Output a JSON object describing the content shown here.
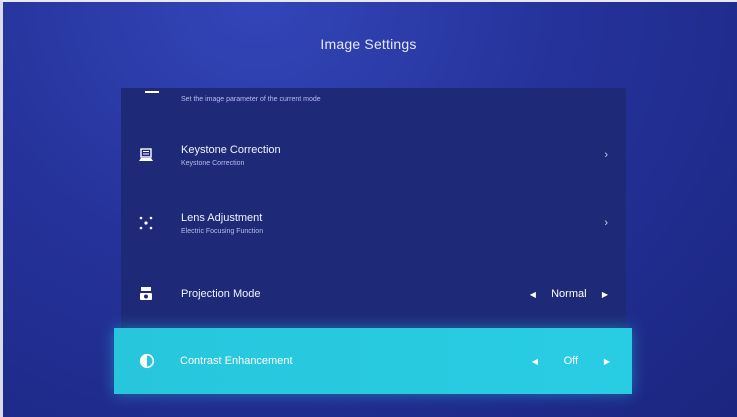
{
  "header": {
    "title": "Image Settings"
  },
  "list": {
    "top_item": {
      "description": "Set the image parameter of the current mode"
    },
    "items": [
      {
        "icon": "keystone-icon",
        "label": "Keystone Correction",
        "subtitle": "Keystone Correction",
        "control": "chevron"
      },
      {
        "icon": "lens-focus-icon",
        "label": "Lens Adjustment",
        "subtitle": "Electric Focusing Function",
        "control": "chevron"
      },
      {
        "icon": "projector-icon",
        "label": "Projection Mode",
        "control": "selector",
        "value": "Normal"
      },
      {
        "icon": "contrast-icon",
        "label": "Contrast Enhancement",
        "control": "selector",
        "value": "Off",
        "selected": true
      }
    ]
  },
  "glyphs": {
    "chevron_right": "›",
    "arrow_left": "◀",
    "arrow_right": "▶"
  },
  "colors": {
    "background": "#25329a",
    "panel": "#1e2a78",
    "highlight": "#29cde3"
  }
}
